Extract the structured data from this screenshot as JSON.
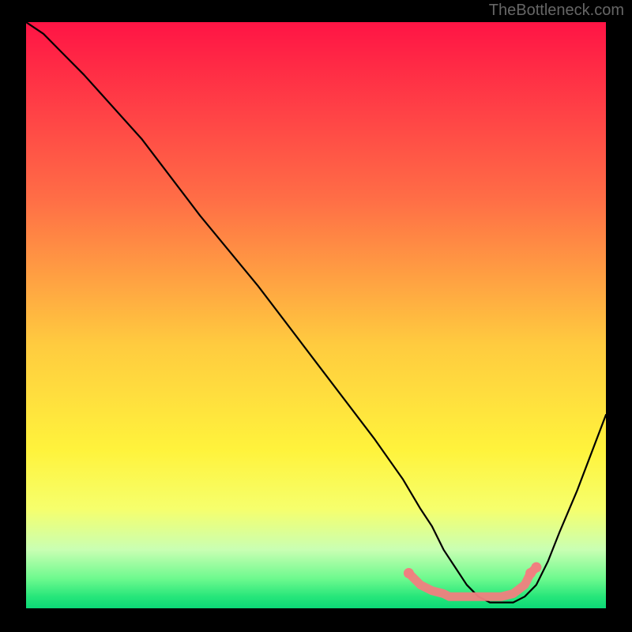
{
  "watermark": "TheBottleneck.com",
  "chart_data": {
    "type": "line",
    "title": "",
    "xlabel": "",
    "ylabel": "",
    "xrange": [
      0,
      100
    ],
    "yrange": [
      0,
      100
    ],
    "series": [
      {
        "name": "curve",
        "x": [
          0,
          3,
          6,
          10,
          20,
          30,
          40,
          50,
          60,
          65,
          68,
          70,
          72,
          74,
          76,
          78,
          80,
          82,
          84,
          86,
          88,
          90,
          92,
          95,
          100
        ],
        "y": [
          100,
          98,
          95,
          91,
          80,
          67,
          55,
          42,
          29,
          22,
          17,
          14,
          10,
          7,
          4,
          2,
          1,
          1,
          1,
          2,
          4,
          8,
          13,
          20,
          33
        ]
      }
    ],
    "markers": {
      "name": "low-zone",
      "color": "#f08080",
      "x": [
        66,
        68,
        70,
        72,
        73,
        74,
        76,
        78,
        80,
        82,
        84,
        86,
        87,
        88
      ],
      "y": [
        6,
        4,
        3,
        2.5,
        2,
        2,
        2,
        2,
        2,
        2,
        2.5,
        4,
        6,
        7
      ]
    },
    "background_gradient": {
      "stops": [
        {
          "offset": 0.0,
          "color": "#ff1445"
        },
        {
          "offset": 0.3,
          "color": "#ff6d46"
        },
        {
          "offset": 0.55,
          "color": "#ffcb3f"
        },
        {
          "offset": 0.73,
          "color": "#fff33c"
        },
        {
          "offset": 0.83,
          "color": "#f6ff6c"
        },
        {
          "offset": 0.9,
          "color": "#c9ffb3"
        },
        {
          "offset": 0.95,
          "color": "#6cf98e"
        },
        {
          "offset": 0.98,
          "color": "#27e67a"
        },
        {
          "offset": 1.0,
          "color": "#0bd977"
        }
      ]
    }
  }
}
